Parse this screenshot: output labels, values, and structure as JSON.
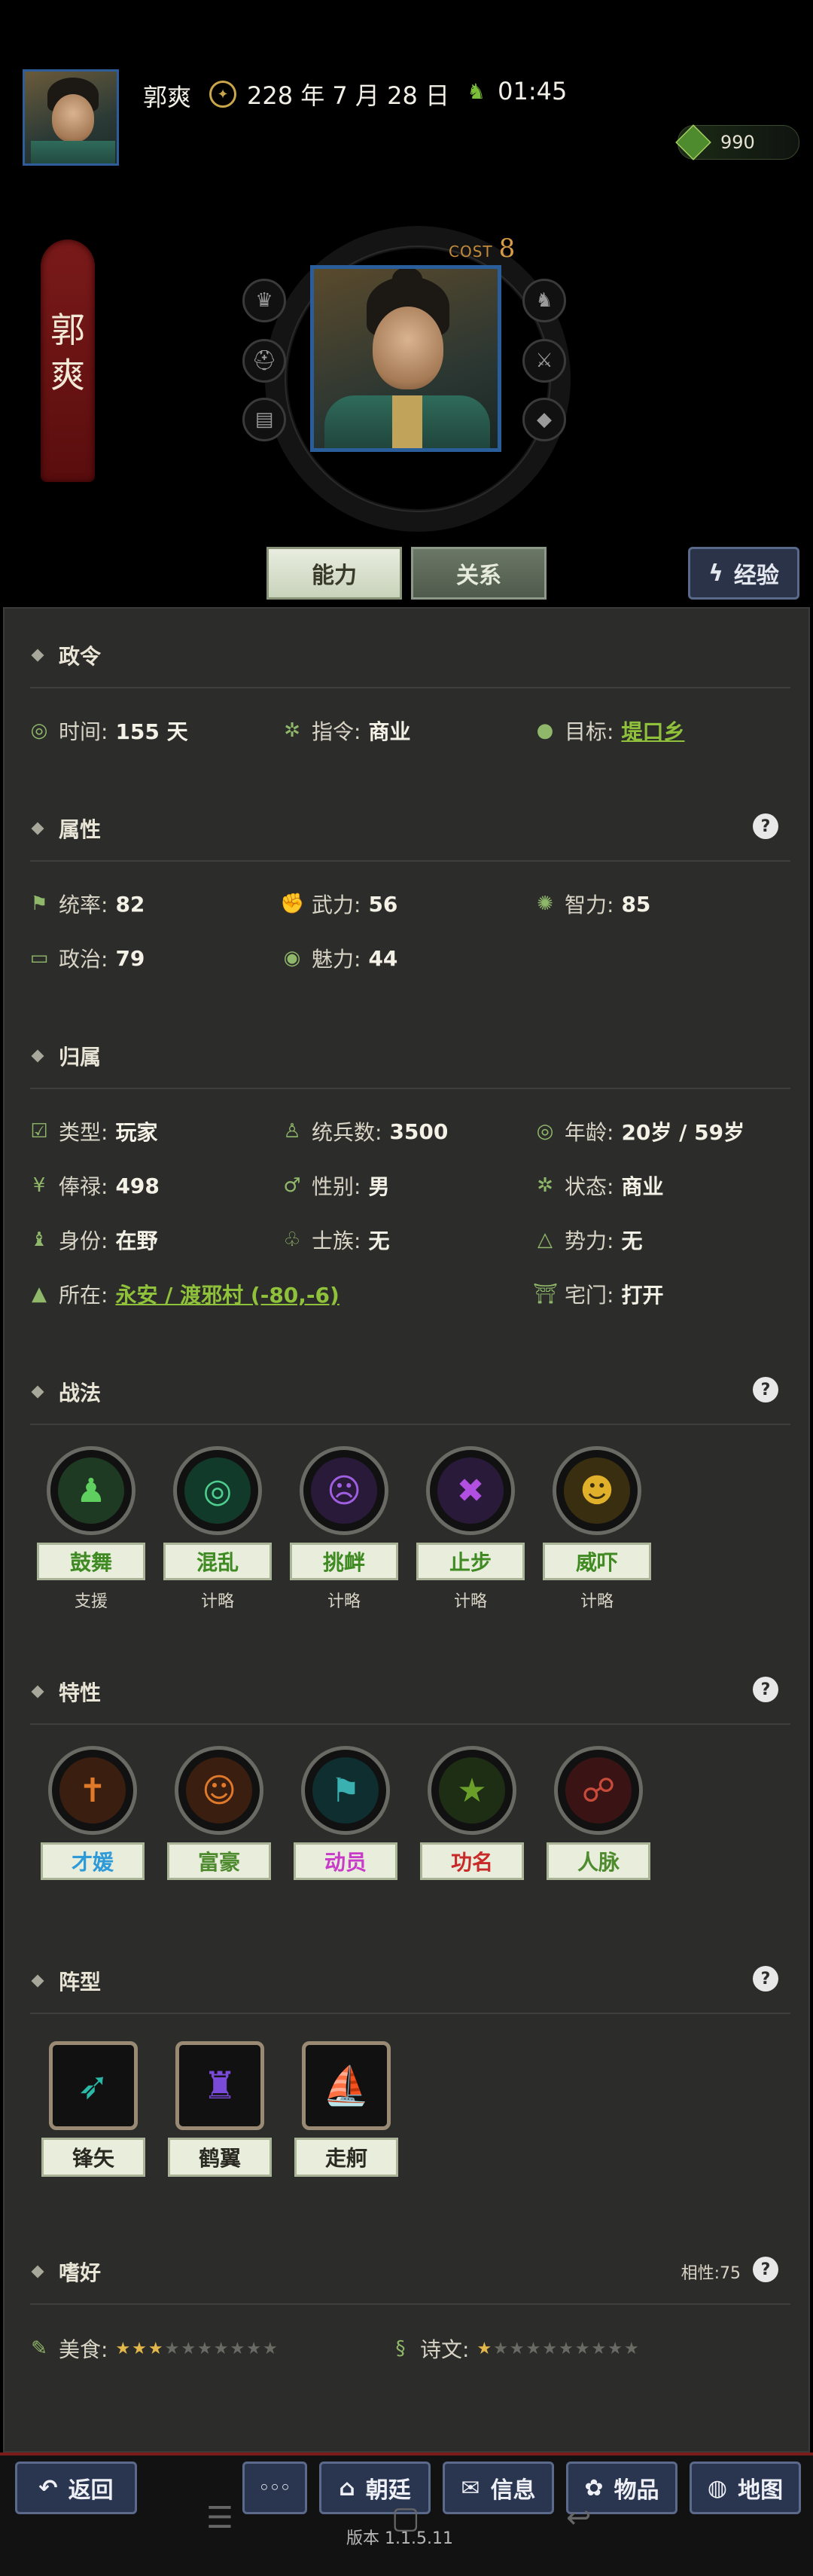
{
  "header": {
    "name": "郭爽",
    "date": "228 年 7 月 28 日",
    "time": "01:45",
    "resource_value": "990"
  },
  "banner_name": [
    "郭",
    "爽"
  ],
  "cost": {
    "label": "COST",
    "value": "8"
  },
  "tabs": {
    "ability": "能力",
    "relations": "关系",
    "experience": "经验"
  },
  "sections": {
    "policy": {
      "title": "政令",
      "time_label": "时间:",
      "time_value": "155 天",
      "order_label": "指令:",
      "order_value": "商业",
      "target_label": "目标:",
      "target_value": "堤口乡"
    },
    "attributes": {
      "title": "属性",
      "items": [
        {
          "label": "统率:",
          "value": "82"
        },
        {
          "label": "武力:",
          "value": "56"
        },
        {
          "label": "智力:",
          "value": "85"
        },
        {
          "label": "政治:",
          "value": "79"
        },
        {
          "label": "魅力:",
          "value": "44"
        }
      ]
    },
    "belonging": {
      "title": "归属",
      "items": [
        {
          "label": "类型:",
          "value": "玩家"
        },
        {
          "label": "统兵数:",
          "value": "3500"
        },
        {
          "label": "年龄:",
          "value": "20岁 / 59岁"
        },
        {
          "label": "俸禄:",
          "value": "498"
        },
        {
          "label": "性别:",
          "value": "男"
        },
        {
          "label": "状态:",
          "value": "商业"
        },
        {
          "label": "身份:",
          "value": "在野"
        },
        {
          "label": "士族:",
          "value": "无"
        },
        {
          "label": "势力:",
          "value": "无"
        },
        {
          "label": "所在:",
          "value": "永安 / 渡邪村 (-80,-6)"
        },
        {
          "label": "宅门:",
          "value": "打开"
        }
      ]
    },
    "tactics": {
      "title": "战法",
      "items": [
        {
          "name": "鼓舞",
          "type": "支援"
        },
        {
          "name": "混乱",
          "type": "计略"
        },
        {
          "name": "挑衅",
          "type": "计略"
        },
        {
          "name": "止步",
          "type": "计略"
        },
        {
          "name": "威吓",
          "type": "计略"
        }
      ]
    },
    "traits": {
      "title": "特性",
      "items": [
        {
          "name": "才媛",
          "color": "#2e9ad8"
        },
        {
          "name": "富豪",
          "color": "#4e8a2e"
        },
        {
          "name": "动员",
          "color": "#c83ac8"
        },
        {
          "name": "功名",
          "color": "#c82a2a"
        },
        {
          "name": "人脉",
          "color": "#4e8a2e"
        }
      ]
    },
    "formation": {
      "title": "阵型",
      "items": [
        {
          "name": "锋矢"
        },
        {
          "name": "鹤翼"
        },
        {
          "name": "走舸"
        }
      ]
    },
    "hobbies": {
      "title": "嗜好",
      "affinity": "相性:75",
      "items": [
        {
          "label": "美食:",
          "stars": 3,
          "max": 10
        },
        {
          "label": "诗文:",
          "stars": 1,
          "max": 10
        }
      ]
    }
  },
  "nav": {
    "back": "返回",
    "more": "◦◦◦",
    "court": "朝廷",
    "info": "信息",
    "items": "物品",
    "map": "地图"
  },
  "version": "版本 1.1.5.11"
}
